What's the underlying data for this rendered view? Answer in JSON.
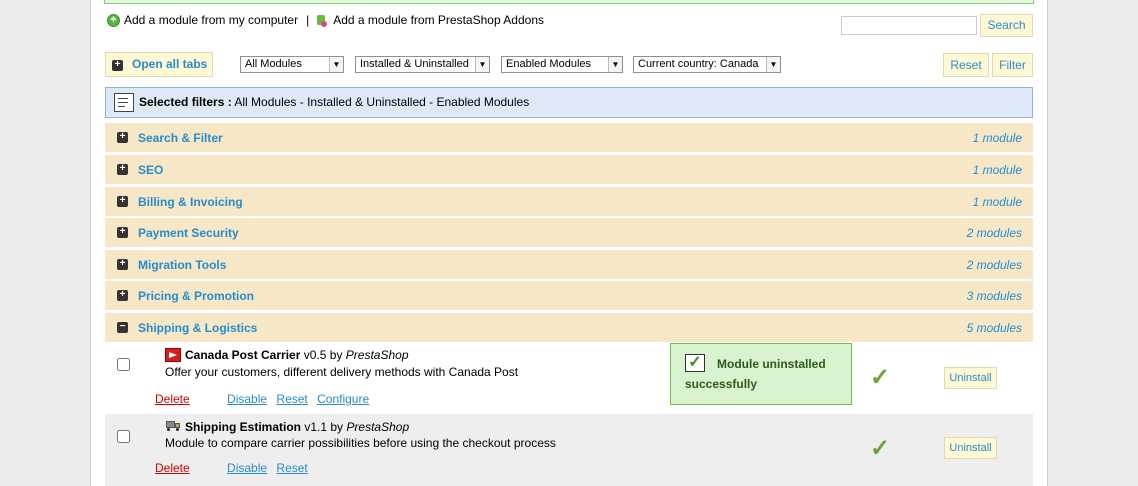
{
  "links": {
    "add_local": "Add a module from my computer",
    "separator": "|",
    "add_addons": "Add a module from PrestaShop Addons"
  },
  "search": {
    "button": "Search",
    "value": ""
  },
  "toolbar": {
    "open_all": "Open all tabs",
    "reset": "Reset",
    "filter": "Filter",
    "filter_modules": "All Modules",
    "filter_install": "Installed & Uninstalled",
    "filter_enabled": "Enabled Modules",
    "filter_country": "Current country: Canada"
  },
  "selected_filters": {
    "label": "Selected filters :",
    "value": "All Modules - Installed & Uninstalled - Enabled Modules"
  },
  "categories": [
    {
      "name": "Search & Filter",
      "count": "1 module",
      "expanded": false
    },
    {
      "name": "SEO",
      "count": "1 module",
      "expanded": false
    },
    {
      "name": "Billing & Invoicing",
      "count": "1 module",
      "expanded": false
    },
    {
      "name": "Payment Security",
      "count": "2 modules",
      "expanded": false
    },
    {
      "name": "Migration Tools",
      "count": "2 modules",
      "expanded": false
    },
    {
      "name": "Pricing & Promotion",
      "count": "3 modules",
      "expanded": false
    },
    {
      "name": "Shipping & Logistics",
      "count": "5 modules",
      "expanded": true
    }
  ],
  "modules": [
    {
      "name": "Canada Post Carrier",
      "version": "v0.5",
      "by": "by",
      "author": "PrestaShop",
      "description": "Offer your customers, different delivery methods with Canada Post",
      "actions": [
        "Delete",
        "Disable",
        "Reset",
        "Configure"
      ],
      "button": "Uninstall"
    },
    {
      "name": "Shipping Estimation",
      "version": "v1.1",
      "by": "by",
      "author": "PrestaShop",
      "description": "Module to compare carrier possibilities before using the checkout process",
      "actions": [
        "Delete",
        "Disable",
        "Reset"
      ],
      "button": "Uninstall"
    }
  ],
  "toast": {
    "line1": "Module uninstalled",
    "line2": "successfully"
  },
  "colors": {
    "accent": "#268ccd",
    "category_bg": "#f6e7c7",
    "filter_bg": "#dde9f7",
    "success": "#6ba23b",
    "delete": "#d00000"
  }
}
